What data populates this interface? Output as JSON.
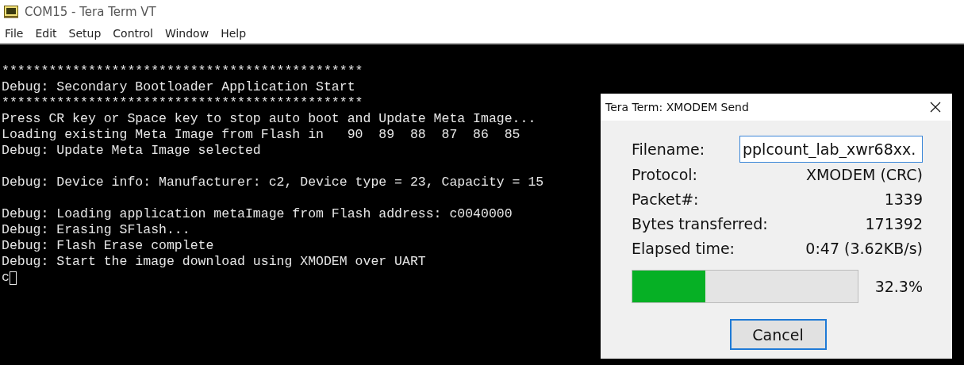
{
  "window": {
    "title": "COM15 - Tera Term VT"
  },
  "menu": [
    "File",
    "Edit",
    "Setup",
    "Control",
    "Window",
    "Help"
  ],
  "terminal": {
    "blocks": [
      [
        "**********************************************",
        "Debug: Secondary Bootloader Application Start",
        "**********************************************",
        "Press CR key or Space key to stop auto boot and Update Meta Image...",
        "Loading existing Meta Image from Flash in   90  89  88  87  86  85",
        "Debug: Update Meta Image selected"
      ],
      [
        "Debug: Device info: Manufacturer: c2, Device type = 23, Capacity = 15"
      ],
      [
        "Debug: Loading application metaImage from Flash address: c0040000",
        "Debug: Erasing SFlash...",
        "Debug: Flash Erase complete",
        "Debug: Start the image download using XMODEM over UART"
      ]
    ],
    "prompt": "c",
    "cursor": true
  },
  "dialog": {
    "title": "Tera Term: XMODEM Send",
    "fields": [
      {
        "kind": "input",
        "label": "Filename:",
        "value": "pplcount_lab_xwr68xx."
      },
      {
        "kind": "text",
        "label": "Protocol:",
        "value": "XMODEM (CRC)"
      },
      {
        "kind": "text",
        "label": "Packet#:",
        "value": "1339"
      },
      {
        "kind": "text",
        "label": "Bytes transferred:",
        "value": "171392"
      },
      {
        "kind": "text",
        "label": "Elapsed time:",
        "value": "0:47 (3.62KB/s)"
      }
    ],
    "progress": {
      "level": 0.323,
      "reading": "32.3%"
    },
    "buttons": [
      "Cancel"
    ]
  }
}
